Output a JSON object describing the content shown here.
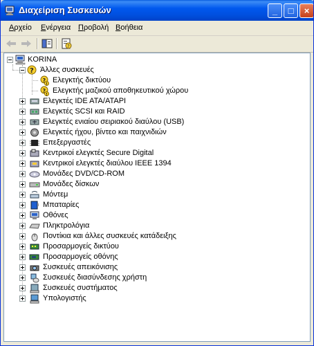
{
  "window": {
    "title": "Διαχείριση Συσκευών"
  },
  "title_buttons": {
    "minimize": "_",
    "maximize": "□",
    "close": "×"
  },
  "menu": [
    {
      "first": "Α",
      "rest": "ρχείο"
    },
    {
      "first": "Ε",
      "rest": "νέργεια"
    },
    {
      "first": "Π",
      "rest": "ροβολή"
    },
    {
      "first": "Β",
      "rest": "οήθεια"
    }
  ],
  "tree": {
    "root": "KORINA",
    "other_devices": {
      "label": "Άλλες συσκευές",
      "children": [
        "Ελεγκτής δικτύου",
        "Ελεγκτής μαζικού αποθηκευτικού χώρου"
      ]
    },
    "categories": [
      {
        "label": "Ελεγκτές IDE ATA/ATAPI",
        "icon": "ide-controller-icon"
      },
      {
        "label": "Ελεγκτές SCSI και RAID",
        "icon": "scsi-controller-icon"
      },
      {
        "label": "Ελεγκτές ενιαίου σειριακού διαύλου (USB)",
        "icon": "usb-controller-icon"
      },
      {
        "label": "Ελεγκτές ήχου, βίντεο και παιχνιδιών",
        "icon": "sound-icon"
      },
      {
        "label": "Επεξεργαστές",
        "icon": "processor-icon"
      },
      {
        "label": "Κεντρικοί ελεγκτές Secure Digital",
        "icon": "sd-host-icon"
      },
      {
        "label": "Κεντρικοί ελεγκτές διαύλου IEEE 1394",
        "icon": "ieee1394-icon"
      },
      {
        "label": "Μονάδες DVD/CD-ROM",
        "icon": "dvd-drive-icon"
      },
      {
        "label": "Μονάδες δίσκων",
        "icon": "disk-drive-icon"
      },
      {
        "label": "Μόντεμ",
        "icon": "modem-icon"
      },
      {
        "label": "Μπαταρίες",
        "icon": "battery-icon"
      },
      {
        "label": "Οθόνες",
        "icon": "monitor-icon"
      },
      {
        "label": "Πληκτρολόγια",
        "icon": "keyboard-icon"
      },
      {
        "label": "Ποντίκια και άλλες συσκευές κατάδειξης",
        "icon": "mouse-icon"
      },
      {
        "label": "Προσαρμογείς δικτύου",
        "icon": "network-adapter-icon"
      },
      {
        "label": "Προσαρμογείς οθόνης",
        "icon": "display-adapter-icon"
      },
      {
        "label": "Συσκευές απεικόνισης",
        "icon": "imaging-device-icon"
      },
      {
        "label": "Συσκευές διασύνδεσης χρήστη",
        "icon": "hid-icon"
      },
      {
        "label": "Συσκευές συστήματος",
        "icon": "system-device-icon"
      },
      {
        "label": "Υπολογιστής",
        "icon": "computer-icon"
      }
    ]
  }
}
